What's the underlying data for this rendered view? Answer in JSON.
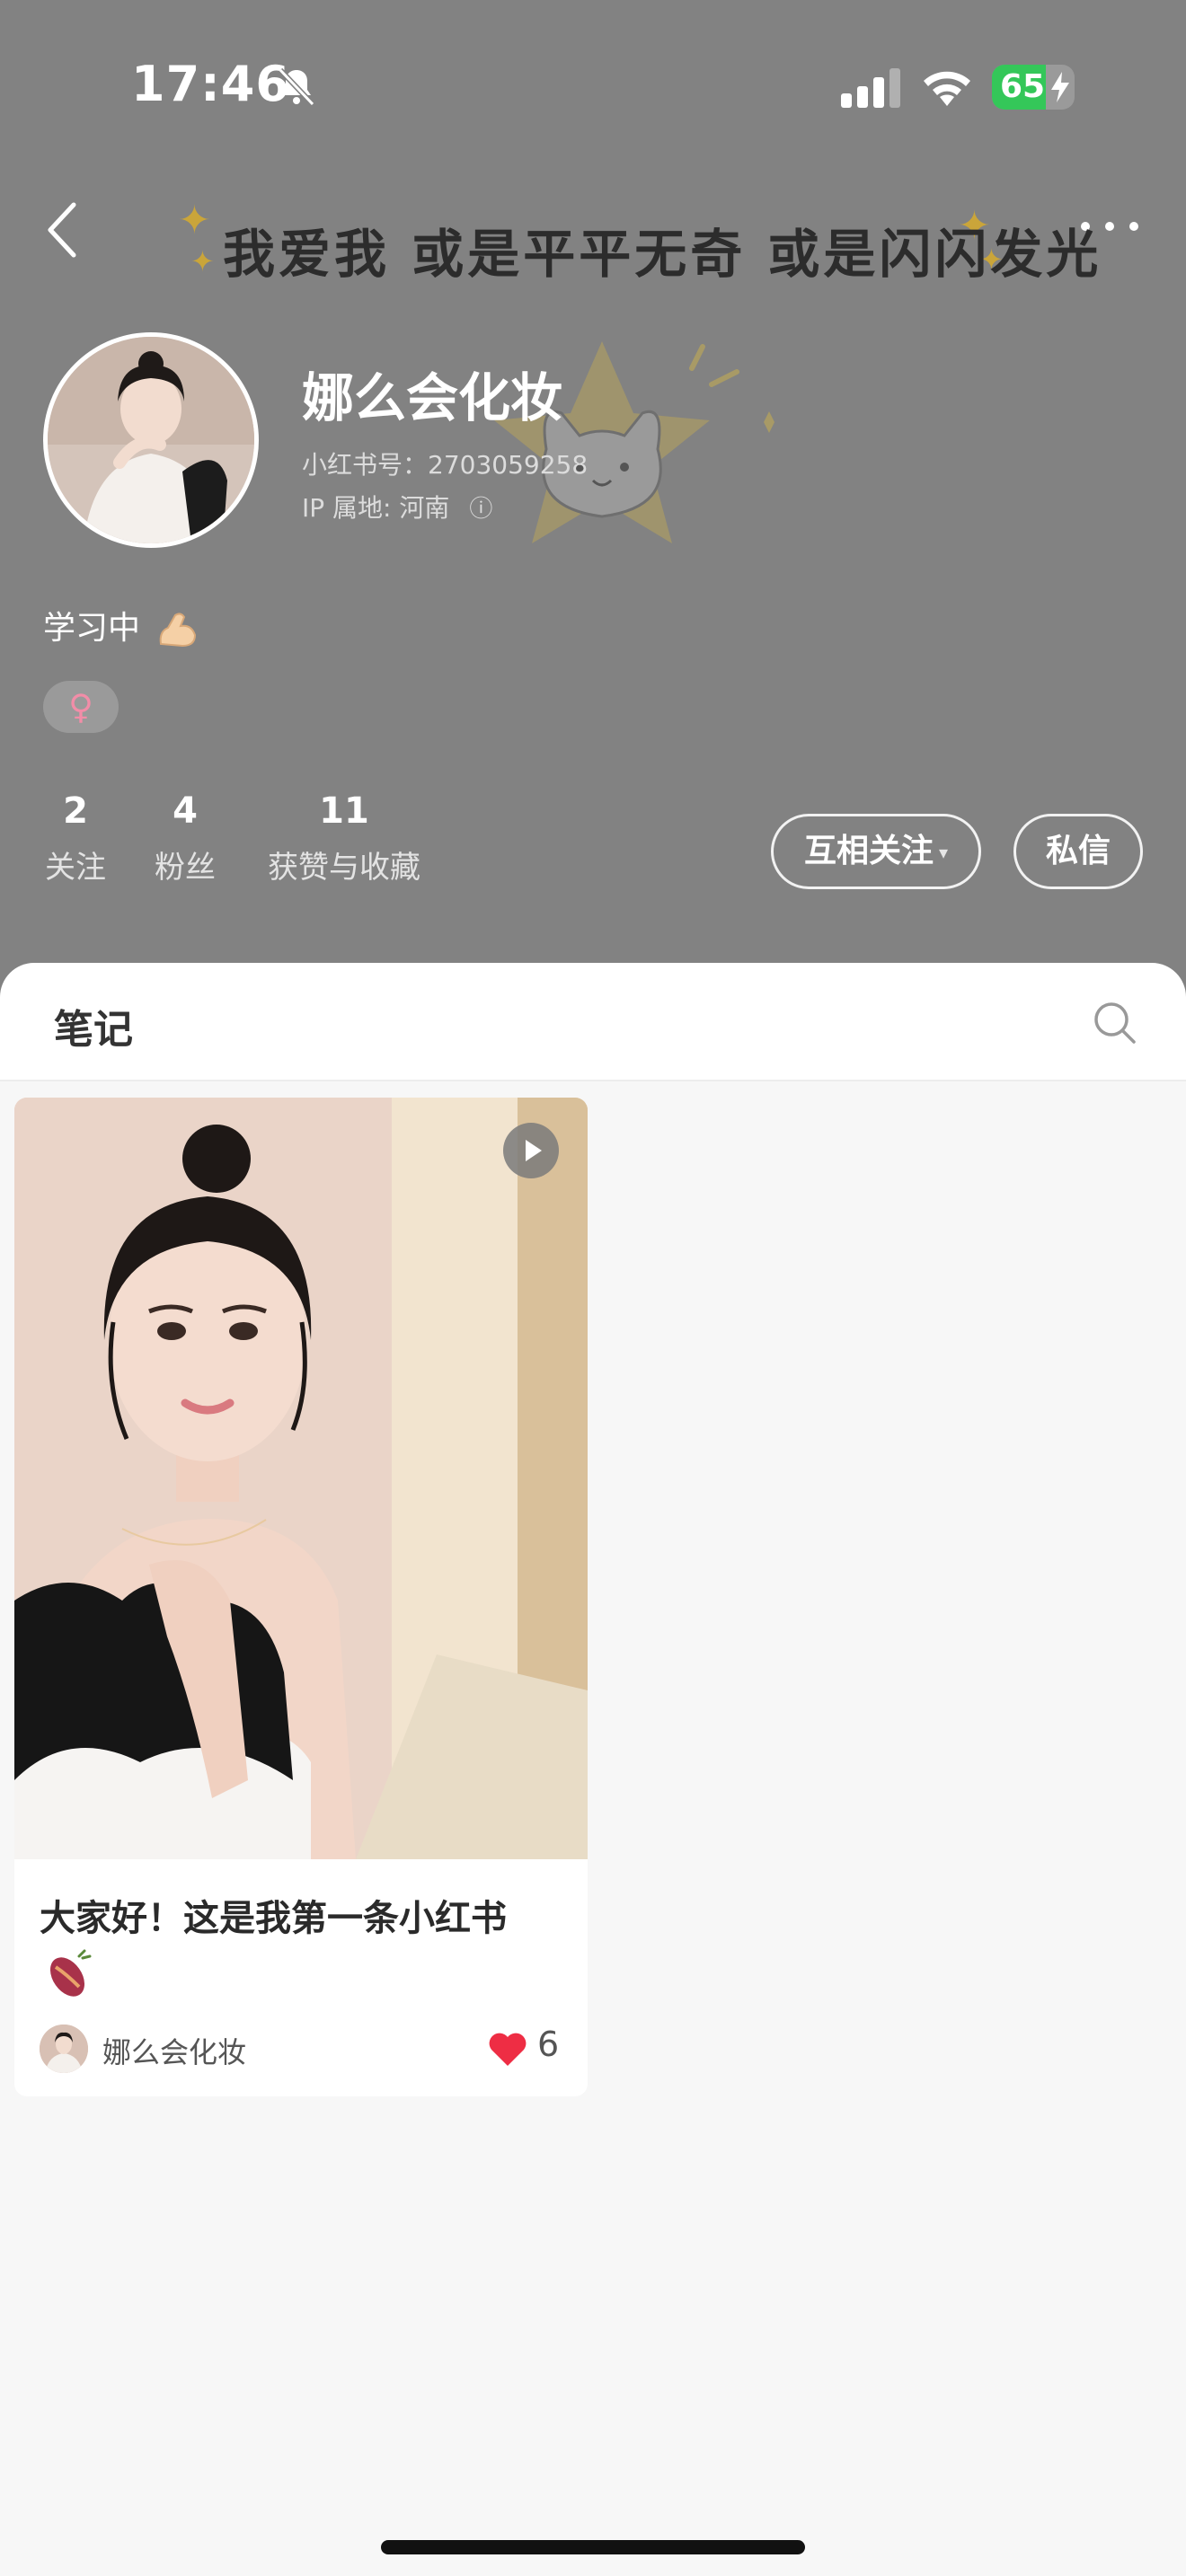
{
  "status_bar": {
    "time": "17:46",
    "battery_level": "65",
    "battery_fraction": 0.65,
    "battery_color": "#34c759"
  },
  "banner": {
    "text": "我爱我 或是平平无奇 或是闪闪发光"
  },
  "profile": {
    "nickname": "娜么会化妆",
    "user_id": "小红书号：2703059258",
    "ip_location": "IP 属地: 河南",
    "info_icon": "ⓘ",
    "bio": "学习中",
    "bio_emoji": "flexed-biceps-icon",
    "gender_symbol": "♀",
    "gender_color": "#f28da8"
  },
  "stats": [
    {
      "value": "2",
      "label": "关注"
    },
    {
      "value": "4",
      "label": "粉丝"
    },
    {
      "value": "11",
      "label": "获赞与收藏"
    }
  ],
  "actions": {
    "follow_label": "互相关注",
    "follow_caret": "▾",
    "message_label": "私信"
  },
  "tabs": {
    "notes_label": "笔记"
  },
  "note": {
    "title": "大家好！这是我第一条小红书",
    "title_emoji": "sweet-potato-icon",
    "author": "娜么会化妆",
    "likes": "6",
    "heart_color": "#ee2d44"
  },
  "colors": {
    "header_bg": "#828282",
    "page_bg": "#f7f7f7"
  }
}
